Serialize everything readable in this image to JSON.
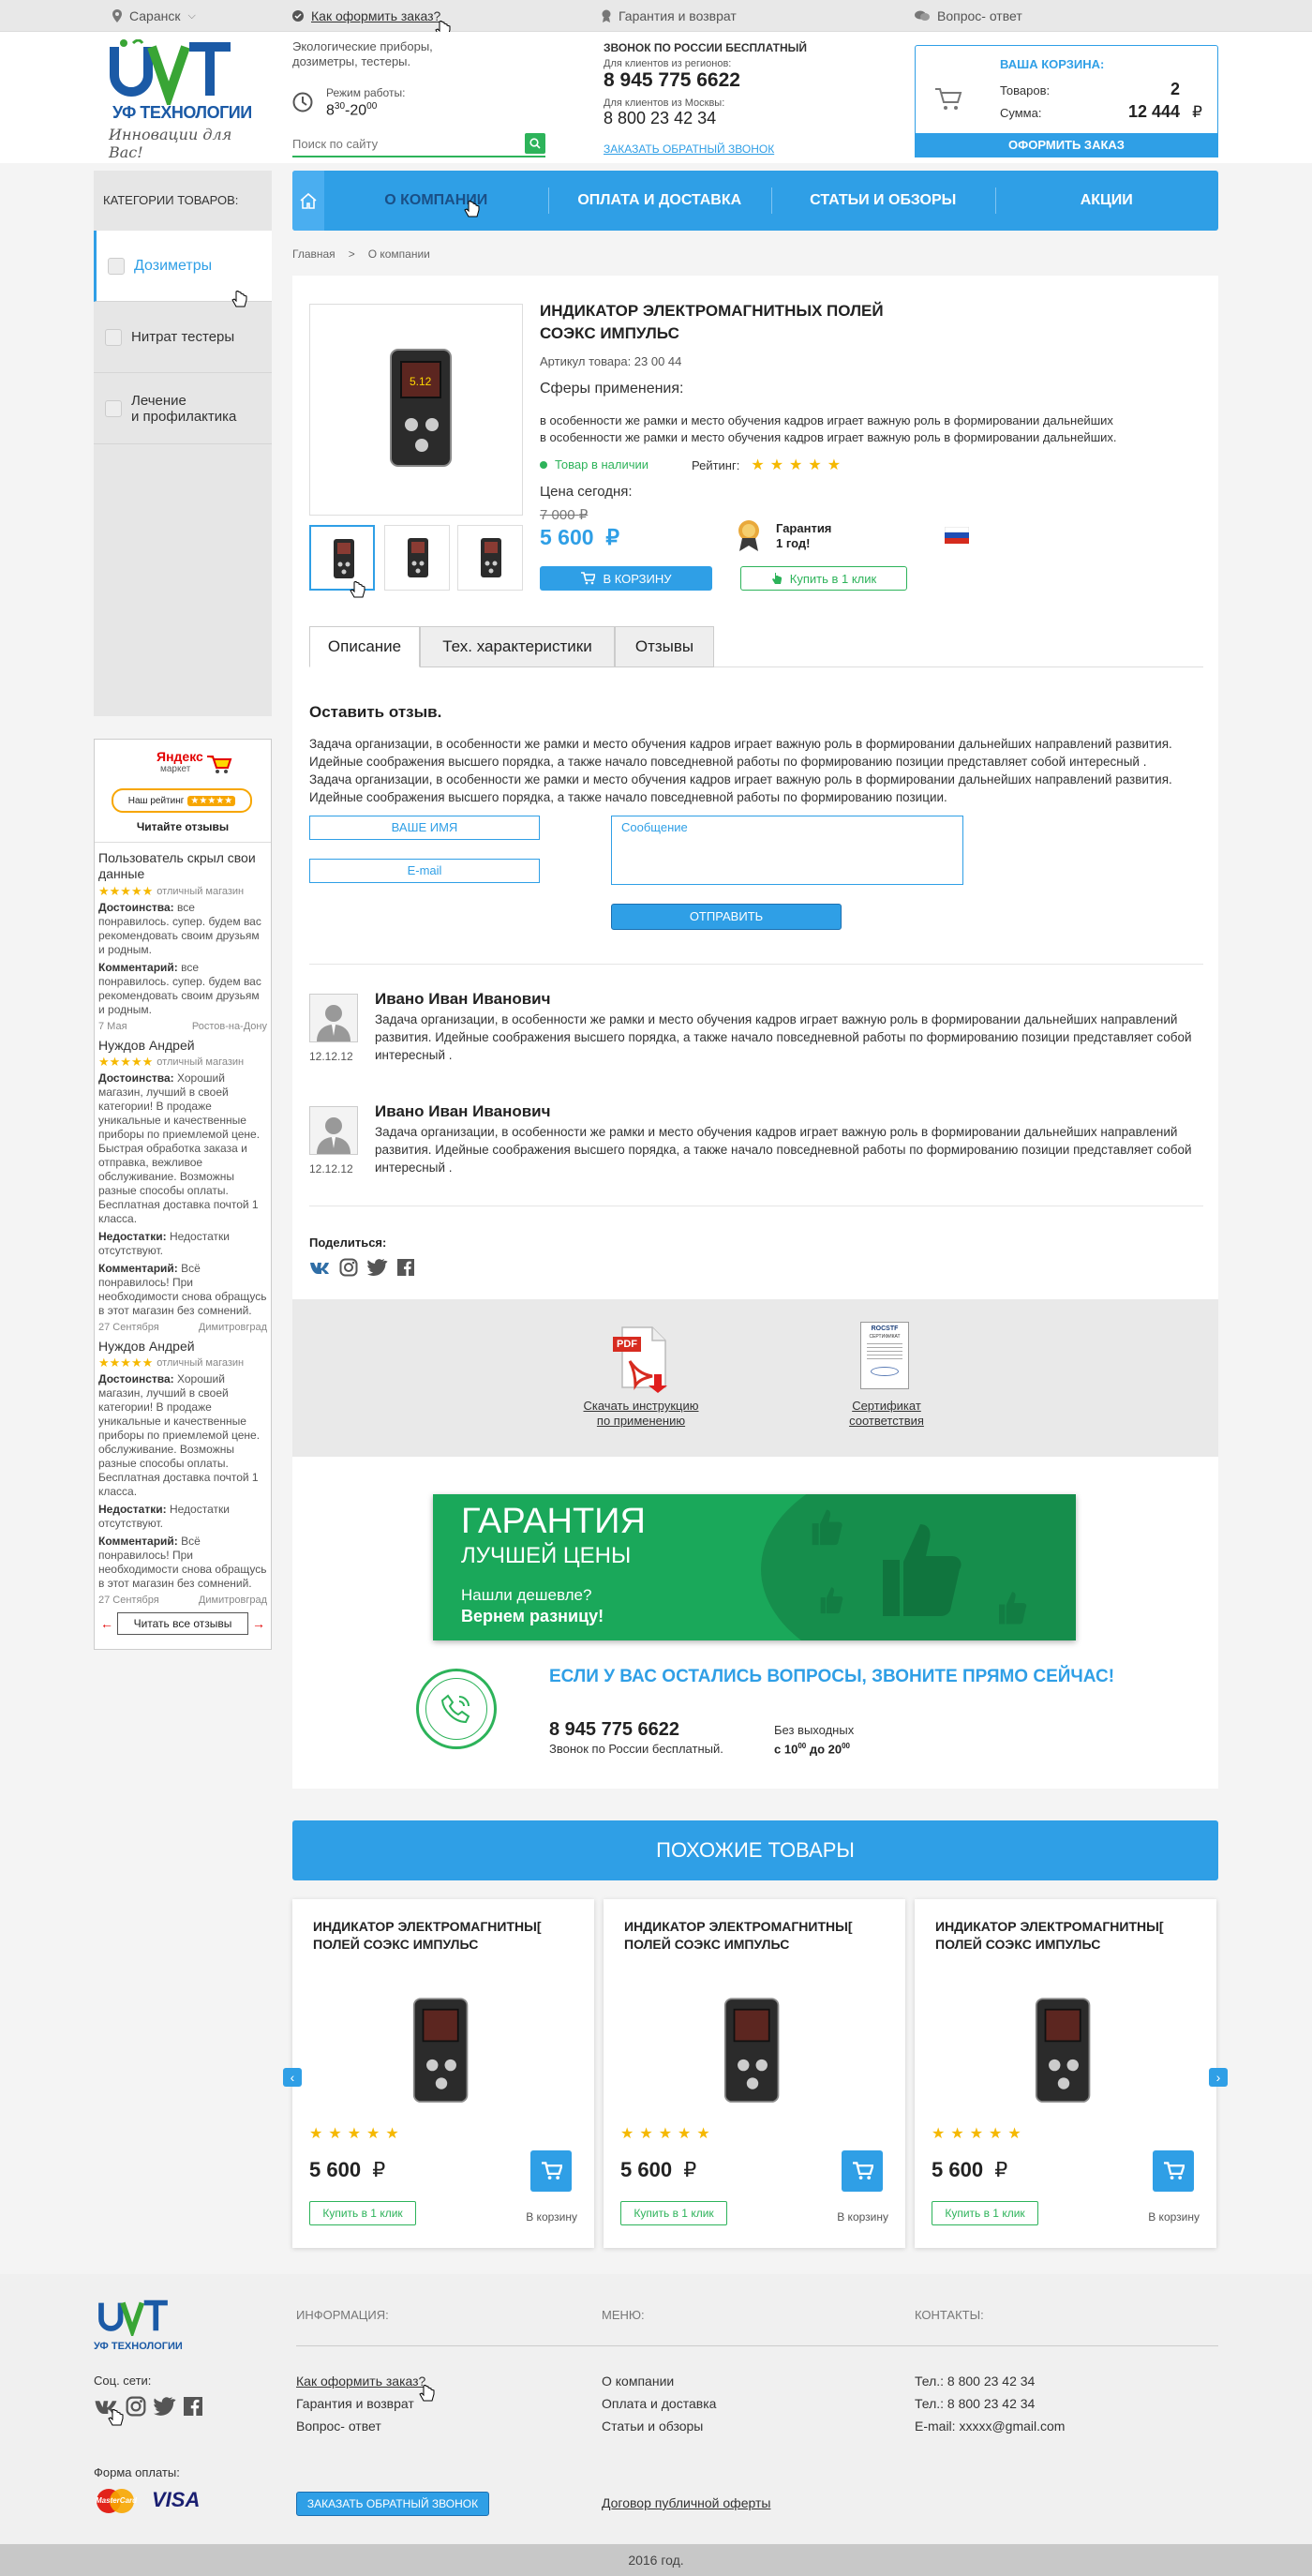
{
  "topbar": {
    "city": "Саранск",
    "how_to_order": "Как оформить заказ?",
    "guarantee": "Гарантия и возврат",
    "faq": "Вопрос- ответ"
  },
  "header": {
    "logo_text": "УФ ТЕХНОЛОГИИ",
    "logo_slogan": "Инновации для Вас!",
    "tagline": "Экологические приборы, дозиметры, тестеры.",
    "hours_label": "Режим работы:",
    "hours_from": "8",
    "hours_from_sup": "30",
    "hours_sep": "-20",
    "hours_to_sup": "00",
    "search_placeholder": "Поиск по сайту",
    "call_free_label": "ЗВОНОК ПО РОССИИ БЕСПЛАТНЫЙ",
    "regions_label": "Для клиентов из регионов:",
    "phone_regions": "8 945 775 6622",
    "moscow_label": "Для клиентов из Москвы:",
    "phone_moscow": "8 800 23 42 34",
    "callback_link": "ЗАКАЗАТЬ ОБРАТНЫЙ ЗВОНОК",
    "cart_title": "ВАША КОРЗИНА:",
    "cart_items_label": "Товаров:",
    "cart_items": "2",
    "cart_sum_label": "Сумма:",
    "cart_sum": "12 444",
    "currency": "₽",
    "checkout_button": "ОФОРМИТЬ ЗАКАЗ"
  },
  "nav": {
    "items": [
      "О КОМПАНИИ",
      "ОПЛАТА И ДОСТАВКА",
      "СТАТЬИ И ОБЗОРЫ",
      "АКЦИИ"
    ]
  },
  "breadcrumb": {
    "home": "Главная",
    "sep": ">",
    "current": "О компании"
  },
  "sidebar": {
    "title": "КАТЕГОРИИ ТОВАРОВ:",
    "items": [
      "Дозиметры",
      "Нитрат тестеры",
      "Лечение\nи профилактика"
    ]
  },
  "product": {
    "title_line1": "ИНДИКАТОР ЭЛЕКТРОМАГНИТНЫХ ПОЛЕЙ",
    "title_line2": "СОЭКС ИМПУЛЬС",
    "article": "Артикул товара: 23 00 44",
    "spheres_title": "Сферы применения:",
    "spheres_text_1": "в особенности же рамки и место обучения кадров играет важную роль в формировании дальнейших",
    "spheres_text_2": "в особенности же рамки и место обучения кадров играет важную роль в формировании дальнейших.",
    "in_stock": "Товар в наличии",
    "rating_label": "Рейтинг:",
    "rating": 5,
    "price_label": "Цена сегодня:",
    "old_price": "7 000",
    "price": "5 600",
    "currency": "₽",
    "to_cart": "В КОРЗИНУ",
    "warranty": "Гарантия\n1 год!",
    "buy_one_click": "Купить в 1 клик",
    "device_screen": "5.12"
  },
  "tabs": [
    "Описание",
    "Тех. характеристики",
    "Отзывы"
  ],
  "review_form": {
    "title": "Оставить отзыв.",
    "intro": "Задача организации, в особенности же рамки и место обучения кадров играет важную роль в формировании дальнейших направлений развития. Идейные соображения высшего порядка, а также начало повседневной работы по формированию позиции представляет собой интересный . Задача организации, в особенности же рамки и место обучения кадров играет важную роль в формировании дальнейших направлений развития. Идейные соображения высшего порядка, а также начало повседневной работы по формированию позиции.",
    "name_field": "ВАШЕ ИМЯ",
    "email_field": "E-mail",
    "message_field": "Сообщение",
    "submit": "ОТПРАВИТЬ"
  },
  "reviews": [
    {
      "name": "Ивано Иван Иванович",
      "date": "12.12.12",
      "text": "Задача организации, в особенности же рамки и место обучения кадров играет важную роль в формировании дальнейших направлений развития. Идейные соображения высшего порядка, а также начало повседневной работы по формированию позиции представляет собой интересный ."
    },
    {
      "name": "Ивано Иван Иванович",
      "date": "12.12.12",
      "text": "Задача организации, в особенности же рамки и место обучения кадров играет важную роль в формировании дальнейших направлений развития. Идейные соображения высшего порядка, а также начало повседневной работы по формированию позиции представляет собой интересный ."
    }
  ],
  "share": {
    "label": "Поделиться:"
  },
  "downloads": {
    "instruction": "Скачать инструкцию\nпо применению",
    "certificate": "Сертификат\nсоответствия",
    "pdf_label": "PDF",
    "cert_brand": "ROCSTF",
    "cert_title": "СЕРТИФИКАТ"
  },
  "promo": {
    "title": "ГАРАНТИЯ",
    "subtitle": "ЛУЧШЕЙ ЦЕНЫ",
    "line1": "Нашли дешевле?",
    "line2": "Вернем разницу!"
  },
  "contact_block": {
    "heading": "ЕСЛИ У ВАС ОСТАЛИСЬ ВОПРОСЫ, ЗВОНИТЕ ПРЯМО СЕЙЧАС!",
    "phone": "8 945 775 6622",
    "phone_note": "Звонок по России бесплатный.",
    "days": "Без выходных",
    "hours_prefix": "с 10",
    "hours_sup1": "00",
    "hours_mid": " до 20",
    "hours_sup2": "00"
  },
  "yandex": {
    "title": "Яндекс",
    "subtitle": "маркет",
    "our_rating": "Наш рейтинг",
    "read_reviews": "Читайте отзывы",
    "shop_label": "отличный магазин",
    "plus_label": "Достоинства:",
    "minus_label": "Недостатки:",
    "comment_label": "Комментарий:",
    "reviews": [
      {
        "name": "Пользователь скрыл свои данные",
        "plus": "все понравилось. супер. будем вас рекомендовать своим друзьям и родным.",
        "comment": "все понравилось. супер. будем вас рекомендовать своим друзьям и родным.",
        "date": "7 Мая",
        "city": "Ростов-на-Дону"
      },
      {
        "name": "Нуждов Андрей",
        "plus": "Хороший магазин, лучший в своей категории! В продаже уникальные и качественные приборы по приемлемой цене. Быстрая обработка заказа и отправка, вежливое обслуживание. Возможны разные способы оплаты. Бесплатная доставка почтой 1 класса.",
        "minus": "Недостатки отсутствуют.",
        "comment": "Всё понравилось! При необходимости снова обращусь в этот магазин без сомнений.",
        "date": "27 Сентября",
        "city": "Димитровград"
      },
      {
        "name": "Нуждов Андрей",
        "plus": "Хороший магазин, лучший в своей категории! В продаже уникальные и качественные приборы по приемлемой цене. обслуживание. Возможны разные способы оплаты. Бесплатная доставка почтой 1 класса.",
        "minus": "Недостатки отсутствуют.",
        "comment": "Всё понравилось! При необходимости снова обращусь в этот магазин без сомнений.",
        "date": "27 Сентября",
        "city": "Димитровград"
      }
    ],
    "read_all": "Читать все отзывы"
  },
  "similar": {
    "title": "ПОХОЖИЕ ТОВАРЫ",
    "products": [
      {
        "title": "ИНДИКАТОР ЭЛЕКТРОМАГНИТНЫ[ ПОЛЕЙ СОЭКС ИМПУЛЬС",
        "price": "5 600",
        "buy": "Купить в 1 клик",
        "in_cart": "В корзину"
      },
      {
        "title": "ИНДИКАТОР ЭЛЕКТРОМАГНИТНЫ[ ПОЛЕЙ СОЭКС ИМПУЛЬС",
        "price": "5 600",
        "buy": "Купить в 1 клик",
        "in_cart": "В корзину"
      },
      {
        "title": "ИНДИКАТОР ЭЛЕКТРОМАГНИТНЫ[ ПОЛЕЙ СОЭКС ИМПУЛЬС",
        "price": "5 600",
        "buy": "Купить в 1 клик",
        "in_cart": "В корзину"
      }
    ]
  },
  "footer": {
    "logo_text": "УФ ТЕХНОЛОГИИ",
    "social_label": "Соц. сети:",
    "payment_label": "Форма оплаты:",
    "mastercard": "MasterCard",
    "visa": "VISA",
    "info_title": "ИНФОРМАЦИЯ:",
    "info_links": [
      "Как оформить заказ?",
      "Гарантия и возврат",
      "Вопрос- ответ"
    ],
    "menu_title": "МЕНЮ:",
    "menu_links": [
      "О компании",
      "Оплата и доставка",
      "Статьи и обзоры"
    ],
    "contacts_title": "КОНТАКТЫ:",
    "contacts": [
      "Тел.: 8 800 23 42 34",
      "Тел.: 8 800 23 42 34",
      "E-mail: xxxxx@gmail.com"
    ],
    "callback": "ЗАКАЗАТЬ ОБРАТНЫЙ ЗВОНОК",
    "offer": "Договор публичной оферты",
    "copyright": "2016 год."
  },
  "colors": {
    "accent": "#2f9fe6",
    "green": "#2db35a",
    "star": "#f5b800",
    "logo_blue": "#1b5aa6"
  }
}
